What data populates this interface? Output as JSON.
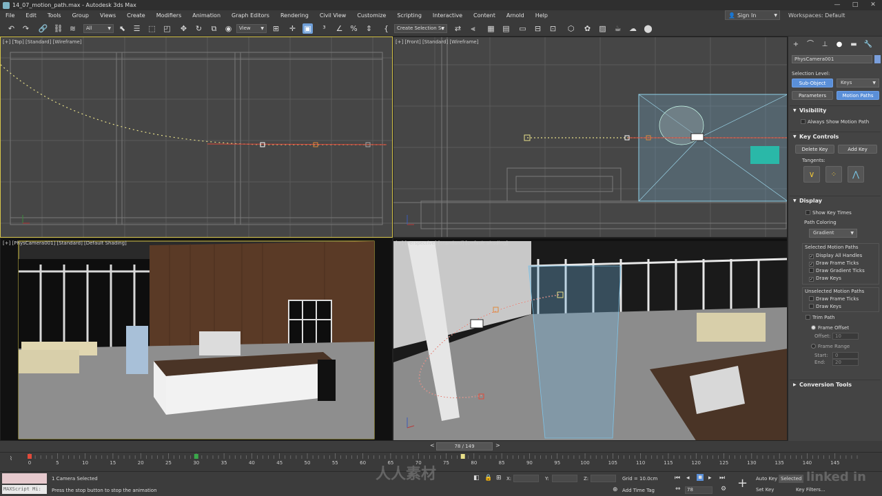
{
  "window": {
    "title": "14_07_motion_path.max - Autodesk 3ds Max",
    "controls": [
      "—",
      "□",
      "✕"
    ]
  },
  "menu": [
    "File",
    "Edit",
    "Tools",
    "Group",
    "Views",
    "Create",
    "Modifiers",
    "Animation",
    "Graph Editors",
    "Rendering",
    "Civil View",
    "Customize",
    "Scripting",
    "Interactive",
    "Content",
    "Arnold",
    "Help"
  ],
  "account": {
    "sign_in": "Sign In",
    "workspaces": "Workspaces: Default"
  },
  "toolbar": {
    "selection_filter": "All",
    "ref_coord": "View",
    "selection_set": "Create Selection Se"
  },
  "viewports": {
    "top": "[+] [Top] [Standard] [Wireframe]",
    "front": "[+] [Front] [Standard] [Wireframe]",
    "camera": "[+] [PhysCamera001] [Standard] [Default Shading]",
    "perspective": "[+] [Perspective] [Standard] [Default Shading]"
  },
  "command_panel": {
    "object_name": "PhysCamera001",
    "selection_level_label": "Selection Level:",
    "sub_object": "Sub-Object",
    "keys_dropdown": "Keys",
    "parameters": "Parameters",
    "motion_paths": "Motion Paths",
    "visibility": {
      "title": "Visibility",
      "always_show": "Always Show Motion Path"
    },
    "key_controls": {
      "title": "Key Controls",
      "delete_key": "Delete Key",
      "add_key": "Add Key",
      "tangents": "Tangents:"
    },
    "display": {
      "title": "Display",
      "show_key_times": "Show Key Times",
      "path_coloring": "Path Coloring",
      "path_coloring_value": "Gradient",
      "selected_title": "Selected Motion Paths",
      "display_all_handles": "Display All Handles",
      "draw_frame_ticks": "Draw Frame Ticks",
      "draw_gradient_ticks": "Draw Gradient Ticks",
      "draw_keys": "Draw Keys",
      "unselected_title": "Unselected Motion Paths",
      "u_draw_frame_ticks": "Draw Frame Ticks",
      "u_draw_keys": "Draw Keys",
      "trim_path": "Trim Path",
      "frame_offset": "Frame Offset",
      "offset_label": "Offset:",
      "offset_value": "10",
      "frame_range": "Frame Range",
      "start_label": "Start:",
      "start_value": "0",
      "end_label": "End:",
      "end_value": "20"
    },
    "conversion_tools": "Conversion Tools"
  },
  "time_slider": {
    "label": "78 / 149",
    "prev": "<",
    "next": ">"
  },
  "trackbar": {
    "ticks": [
      0,
      5,
      10,
      15,
      20,
      25,
      30,
      35,
      40,
      45,
      50,
      55,
      60,
      65,
      70,
      75,
      80,
      85,
      90,
      95,
      100,
      105,
      110,
      115,
      120,
      125,
      130,
      135,
      140,
      145
    ]
  },
  "status": {
    "maxscript": "MAXScript Mi:",
    "selected": "1 Camera Selected",
    "prompt": "Press the stop button to stop the animation",
    "x_label": "X:",
    "y_label": "Y:",
    "z_label": "Z:",
    "grid": "Grid = 10.0cm",
    "add_time_tag": "Add Time Tag",
    "frame_field": "78",
    "auto_key": "Auto Key",
    "set_key": "Set Key",
    "selected_dropdown": "Selected",
    "key_filters": "Key Filters..."
  },
  "watermark": {
    "text": "人人素材",
    "linkedin": "linked in"
  },
  "colors": {
    "accent": "#5a8fd8",
    "active_viewport": "#d8c64a",
    "path": "#e8e08a",
    "key_red": "#e24a3a"
  }
}
